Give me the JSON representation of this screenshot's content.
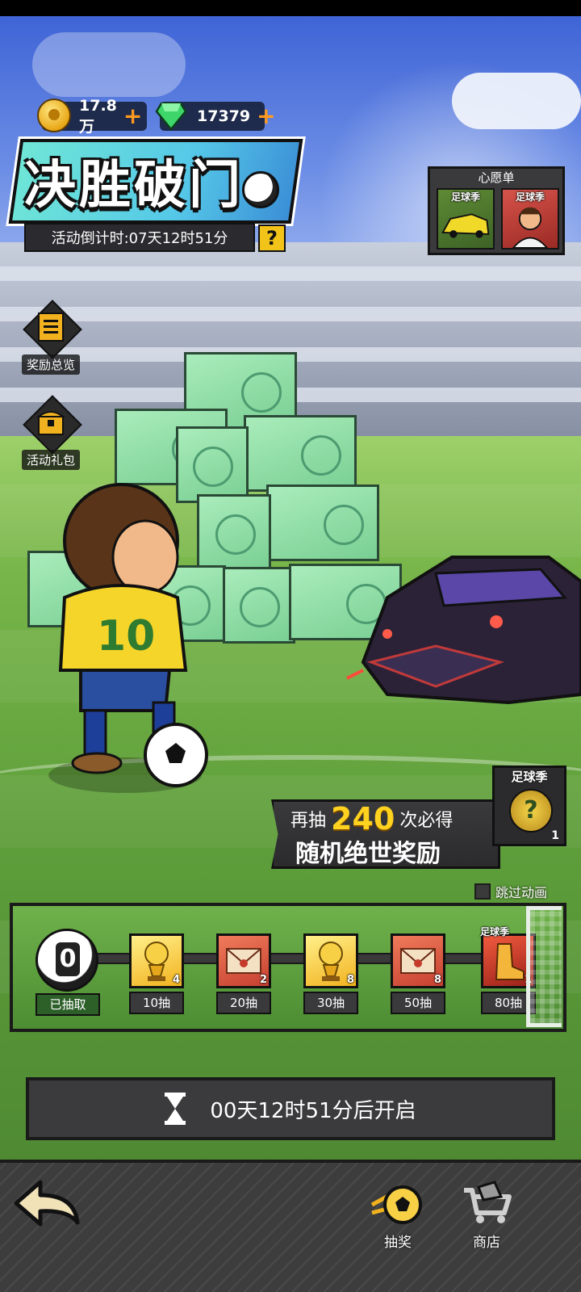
{
  "currency": {
    "coins": "17.8万",
    "gems": "17379",
    "add_symbol": "+"
  },
  "event": {
    "title": "决胜破门",
    "countdown": "活动倒计时:07天12时51分",
    "help_symbol": "?"
  },
  "wishlist": {
    "title": "心愿单",
    "items": [
      {
        "tag": "足球季"
      },
      {
        "tag": "足球季"
      }
    ]
  },
  "side_menu": {
    "rewards_overview": "奖励总览",
    "event_pack": "活动礼包"
  },
  "promo": {
    "line1_prefix": "再抽",
    "line1_count": "240",
    "line1_suffix": "次必得",
    "line2": "随机绝世奖励",
    "card_tag": "足球季",
    "card_symbol": "?",
    "card_count": "1"
  },
  "skip_animation": "跳过动画",
  "progress": {
    "drawn_count": "0",
    "drawn_label": "已抽取",
    "milestones": [
      {
        "type": "trophy",
        "count": "4",
        "label": "10抽"
      },
      {
        "type": "mail",
        "count": "2",
        "label": "20抽"
      },
      {
        "type": "trophy",
        "count": "8",
        "label": "30抽"
      },
      {
        "type": "mail",
        "count": "8",
        "label": "50抽"
      },
      {
        "type": "final",
        "count": "1",
        "label": "80抽",
        "tag": "足球季"
      }
    ]
  },
  "timer": {
    "text": "00天12时51分后开启"
  },
  "bottom_nav": {
    "tabs": [
      {
        "label": "抽奖",
        "icon": "soccer-ball-icon",
        "active": true
      },
      {
        "label": "商店",
        "icon": "shop-cart-icon",
        "active": false
      }
    ]
  },
  "colors": {
    "accent_gold": "#ffd21f",
    "plus_orange": "#ff9a1f",
    "panel_dark": "#3b3b3d"
  }
}
